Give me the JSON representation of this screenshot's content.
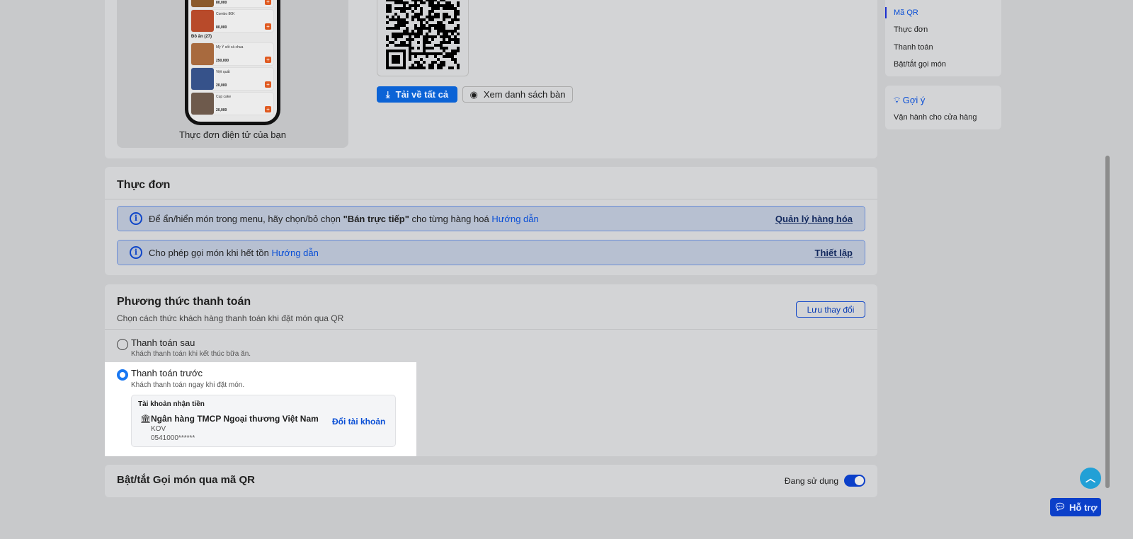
{
  "qr_section": {
    "phone_caption": "Thực đơn điện tử của bạn",
    "phone_items": [
      {
        "name": "",
        "price": "80,000",
        "color": "#8b5a2b"
      },
      {
        "name": "Combo 80K",
        "price": "80,000",
        "color": "#b84a2a"
      },
      {
        "name": "Mỳ Ý sốt cà chua",
        "price": "250,000",
        "color": "#a86a3e"
      },
      {
        "name": "Việt quất",
        "price": "20,000",
        "color": "#36528a"
      },
      {
        "name": "Cup cake",
        "price": "20,000",
        "color": "#6e5a4c"
      }
    ],
    "phone_section_label": "Đồ ăn (27)",
    "download_all": "Tải về tất cả",
    "view_tables": "Xem danh sách bàn"
  },
  "menu_section": {
    "title": "Thực đơn",
    "alert1": {
      "text": "Để ẩn/hiển món trong menu, hãy chọn/bỏ chọn ",
      "bold": "\"Bán trực tiếp\"",
      "text2": " cho từng hàng hoá ",
      "guide": "Hướng dẫn",
      "action": "Quản lý hàng hóa"
    },
    "alert2": {
      "text": "Cho phép gọi món khi hết tồn ",
      "guide": "Hướng dẫn",
      "action": "Thiết lập"
    }
  },
  "payment_section": {
    "title": "Phương thức thanh toán",
    "subtitle": "Chọn cách thức khách hàng thanh toán khi đặt món qua QR",
    "save": "Lưu thay đổi",
    "options": [
      {
        "label": "Thanh toán sau",
        "desc": "Khách thanh toán khi kết thúc bữa ăn.",
        "selected": false
      },
      {
        "label": "Thanh toán trước",
        "desc": "Khách thanh toán ngay khi đặt món.",
        "selected": true
      }
    ],
    "account": {
      "heading": "Tài khoản nhận tiền",
      "bank": "Ngân hàng TMCP Ngoại thương Việt Nam",
      "holder": "KOV",
      "number": "0541000******",
      "change": "Đổi tài khoản"
    }
  },
  "toggle_section": {
    "title": "Bật/tắt Gọi món qua mã QR",
    "status": "Đang sử dụng",
    "enabled": true
  },
  "sidebar": {
    "nav": [
      "Mã QR",
      "Thực đơn",
      "Thanh toán",
      "Bật/tắt gọi món"
    ],
    "active": "Mã QR",
    "tips_title": "Gợi ý",
    "tips_item": "Vận hành cho cửa hàng"
  },
  "support_label": "Hỗ trợ",
  "colors": {
    "accent": "#0b63d6",
    "toggle": "#0b3fc9",
    "scroll_top": "#22a0d6"
  }
}
